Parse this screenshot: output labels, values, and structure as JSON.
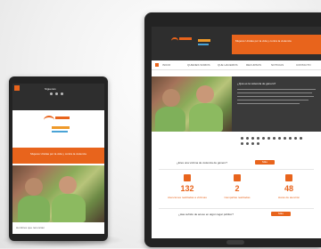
{
  "colors": {
    "accent": "#e8641c",
    "device": "#232323",
    "green": "#7fb05a"
  },
  "phone": {
    "banner_text": "Mujeres Unidas por la vida y contra la violencia",
    "footer_text": "Hombres que renuncian",
    "icons": [
      "menu-icon",
      "facebook-icon",
      "twitter-icon",
      "youtube-icon"
    ]
  },
  "tablet": {
    "header_text": "Mujeres Unidas por la vida y contra la violencia",
    "nav_items": [
      "INICIO",
      "QUIENES SOMOS",
      "QUE HACEMOS",
      "RECURSOS",
      "NOTICIAS",
      "CONTACTO"
    ],
    "article_title": "¿Qué es la violencia de género?",
    "question": "¿Eres una víctima de violencia de género?",
    "question_button": "Más",
    "stats": [
      {
        "value": "132",
        "icon": "calendar-icon",
        "caption": "Atenciones realizadas a víctimas"
      },
      {
        "value": "2",
        "icon": "document-icon",
        "caption": "Campañas realizadas"
      },
      {
        "value": "48",
        "icon": "hourglass-icon",
        "caption": "Horas de atención"
      }
    ],
    "footer_question": "¿Has sufrido de acoso en algún lugar público?",
    "footer_button": "Más"
  }
}
